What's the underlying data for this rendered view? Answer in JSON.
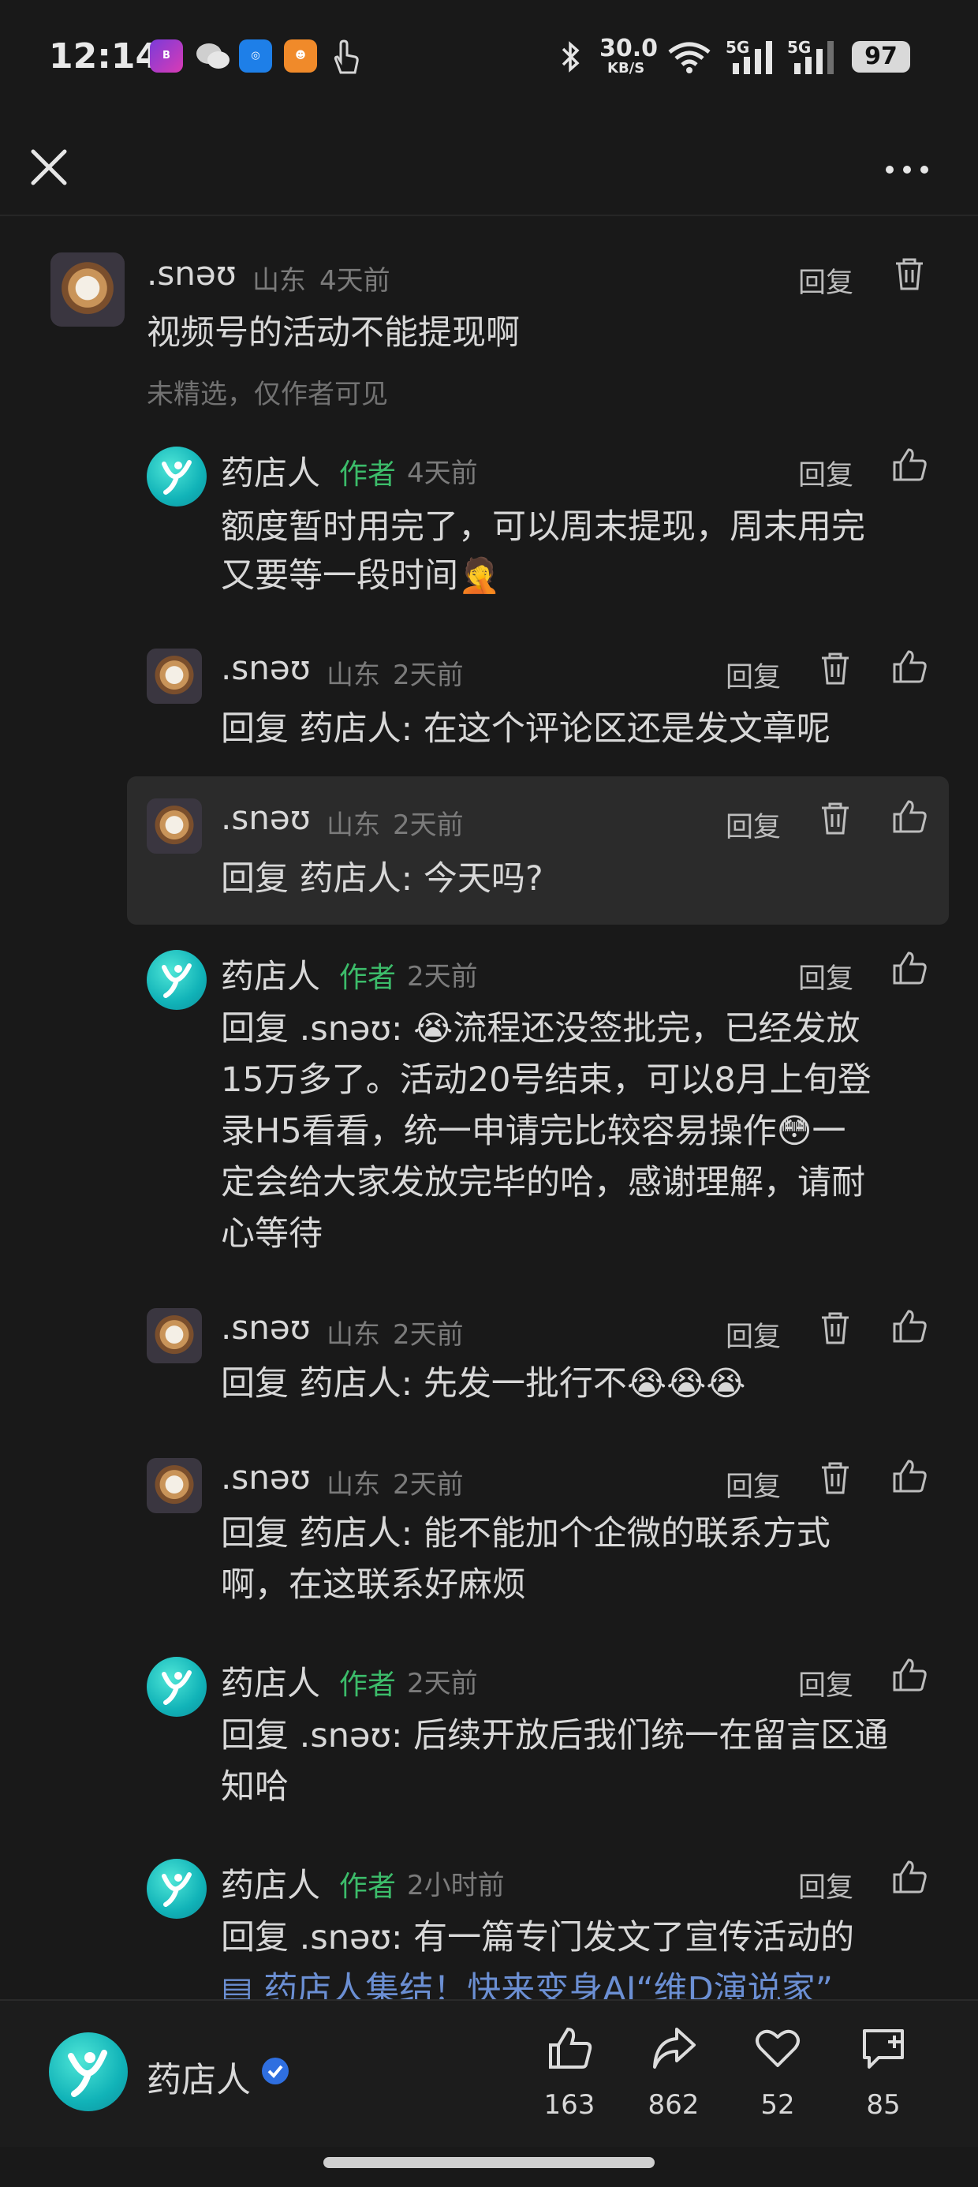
{
  "status_bar": {
    "time": "12:14",
    "speed": "30.0",
    "speed_unit": "KB/S",
    "network_1": "5G",
    "network_2": "5G",
    "battery": "97",
    "app_icons": [
      "bank-app-icon",
      "wechat-icon",
      "file-app-icon",
      "video-app-icon",
      "touch-icon"
    ]
  },
  "nav": {
    "close_icon": "close-icon",
    "more_icon": "more-icon"
  },
  "comments": [
    {
      "user": ".snəʊ",
      "location": "山东",
      "time": "4天前",
      "text": "视频号的活动不能提现啊",
      "hint": "未精选，仅作者可见",
      "reply_label": "回复"
    },
    {
      "user": "药店人",
      "author_tag": "作者",
      "time": "4天前",
      "text_line1": "额度暂时用完了，可以周末提现，周末用完",
      "text_line2": "又要等一段时间🤦",
      "reply_label": "回复"
    },
    {
      "user": ".snəʊ",
      "location": "山东",
      "time": "2天前",
      "text": "回复 药店人: 在这个评论区还是发文章呢",
      "reply_label": "回复"
    },
    {
      "user": ".snəʊ",
      "location": "山东",
      "time": "2天前",
      "text": "回复 药店人: 今天吗?",
      "reply_label": "回复"
    },
    {
      "user": "药店人",
      "author_tag": "作者",
      "time": "2天前",
      "text_line1": "回复 .snəʊ: 😭流程还没签批完，已经发放",
      "text_line2": "15万多了。活动20号结束，可以8月上旬登",
      "text_line3": "录H5看看，统一申请完比较容易操作😳一",
      "text_line4": "定会给大家发放完毕的哈，感谢理解，请耐",
      "text_line5": "心等待",
      "reply_label": "回复"
    },
    {
      "user": ".snəʊ",
      "location": "山东",
      "time": "2天前",
      "text": "回复 药店人: 先发一批行不😭😭😭",
      "reply_label": "回复"
    },
    {
      "user": ".snəʊ",
      "location": "山东",
      "time": "2天前",
      "text_line1": "回复 药店人: 能不能加个企微的联系方式",
      "text_line2": "啊，在这联系好麻烦",
      "reply_label": "回复"
    },
    {
      "user": "药店人",
      "author_tag": "作者",
      "time": "2天前",
      "text_line1": "回复 .snəʊ: 后续开放后我们统一在留言区通",
      "text_line2": "知哈",
      "reply_label": "回复"
    },
    {
      "user": "药店人",
      "author_tag": "作者",
      "time": "2小时前",
      "text_line1": "回复 .snəʊ: 有一篇专门发文了宣传活动的",
      "link_text": "药店人集结！快来变身AI“维D演说家”",
      "reply_label": "回复"
    }
  ],
  "bottom_bar": {
    "account_name": "药店人",
    "verified_icon": "verified-badge-icon",
    "like_count": "163",
    "share_count": "862",
    "favorite_count": "52",
    "comment_count": "85"
  },
  "colors": {
    "background": "#191919",
    "author_green": "#3cbc6a",
    "link_blue": "#6b8fd3",
    "verified_blue": "#2f6fe0"
  }
}
